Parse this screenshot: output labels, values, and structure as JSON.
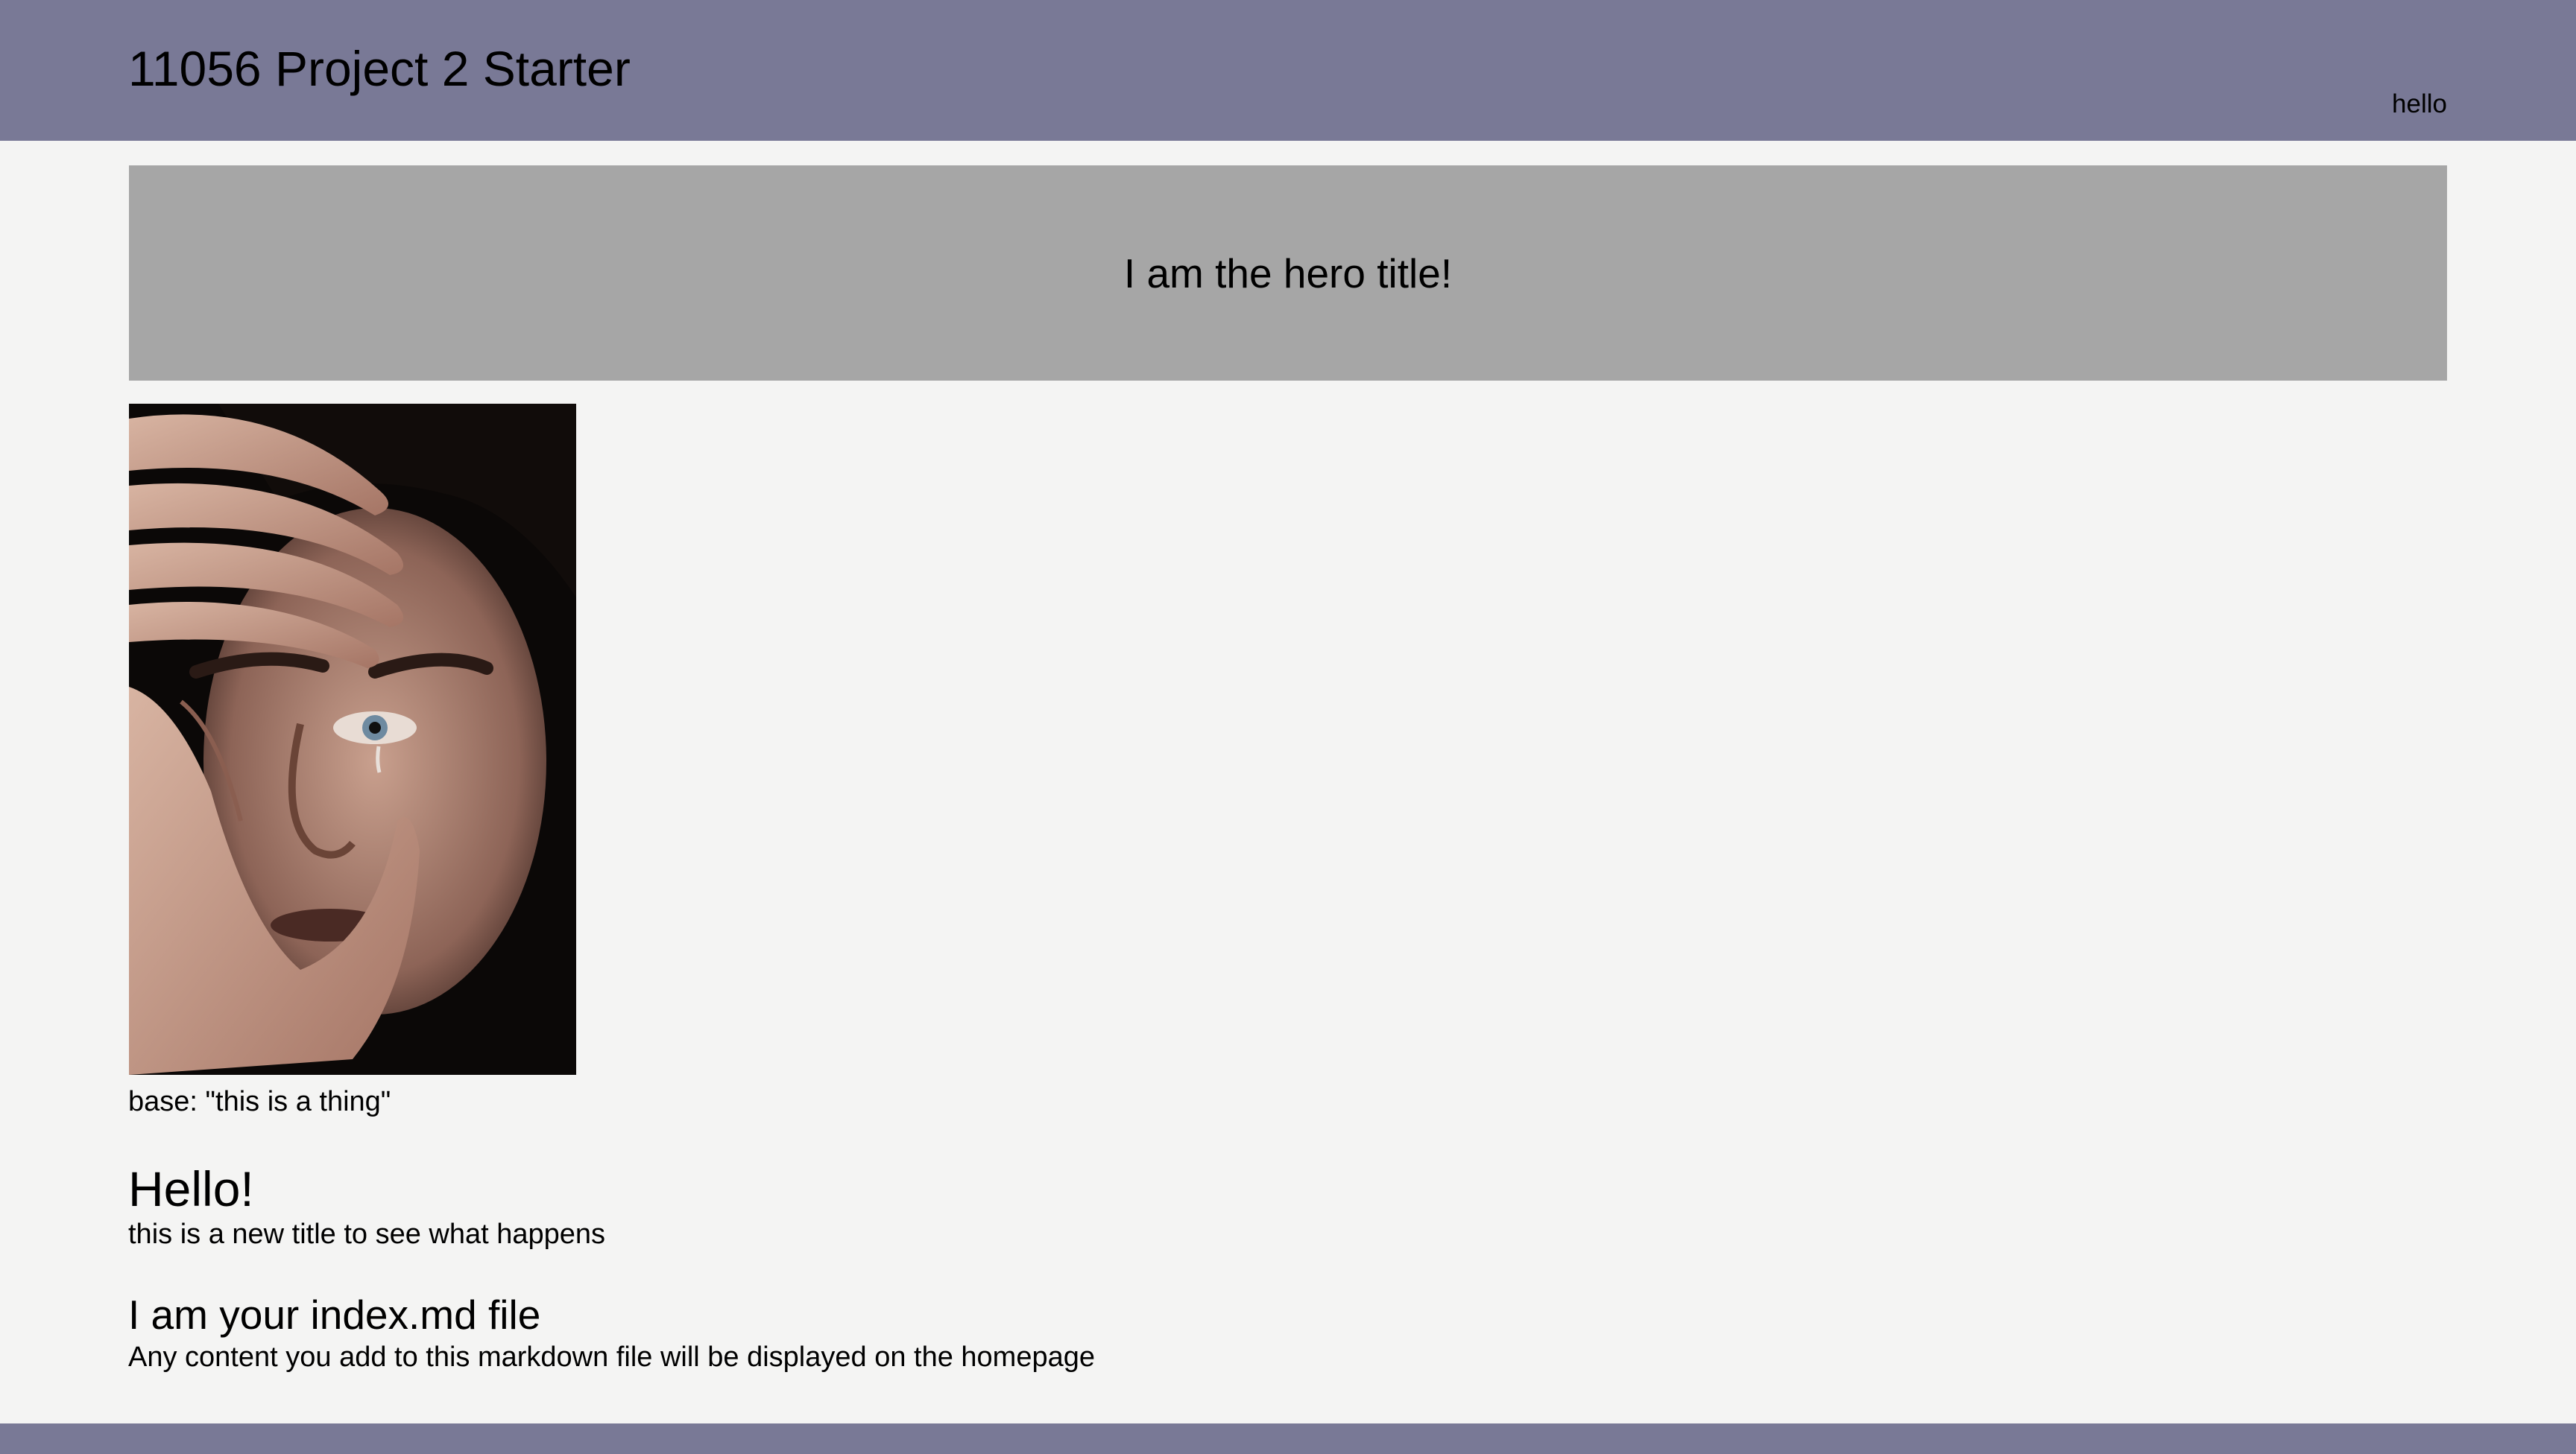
{
  "header": {
    "site_title": "11056 Project 2 Starter",
    "nav_link": "hello"
  },
  "hero": {
    "title": "I am the hero title!"
  },
  "image": {
    "caption": "base: \"this is a thing\""
  },
  "content": {
    "hello_heading": "Hello!",
    "hello_text": "this is a new title to see what happens",
    "index_heading": "I am your index.md file",
    "index_text": "Any content you add to this markdown file will be displayed on the homepage"
  },
  "colors": {
    "header_bg": "#797996",
    "page_bg": "#f4f4f3",
    "hero_bg": "#a6a6a6"
  }
}
